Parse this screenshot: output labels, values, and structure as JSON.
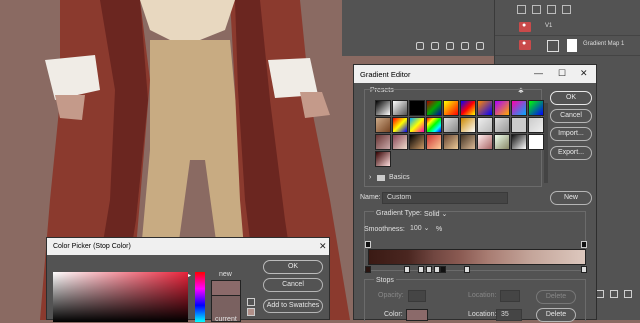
{
  "layers_panel": {
    "group_name": "V1",
    "gradient_layer_name": "Gradient Map 1"
  },
  "gradient_editor": {
    "title": "Gradient Editor",
    "presets_label": "Presets",
    "folder_label": "Basics",
    "buttons": {
      "ok": "OK",
      "cancel": "Cancel",
      "import": "Import...",
      "export": "Export...",
      "new": "New"
    },
    "name_label": "Name:",
    "name_value": "Custom",
    "gradient_type_label": "Gradient Type:",
    "gradient_type_value": "Solid",
    "smoothness_label": "Smoothness:",
    "smoothness_value": "100",
    "smoothness_unit": "%",
    "stops_label": "Stops",
    "opacity_label": "Opacity:",
    "opacity_location_label": "Location:",
    "opacity_delete": "Delete",
    "color_label": "Color:",
    "color_location_label": "Location:",
    "color_location_value": "35",
    "color_delete": "Delete",
    "colors": {
      "stop_color": "#8b6a6a"
    }
  },
  "color_picker": {
    "title": "Color Picker (Stop Color)",
    "new_label": "new",
    "current_label": "current",
    "buttons": {
      "ok": "OK",
      "cancel": "Cancel",
      "add_to_swatches": "Add to Swatches"
    },
    "colors": {
      "new": "#8b6a6a",
      "current": "#7a6160"
    }
  }
}
